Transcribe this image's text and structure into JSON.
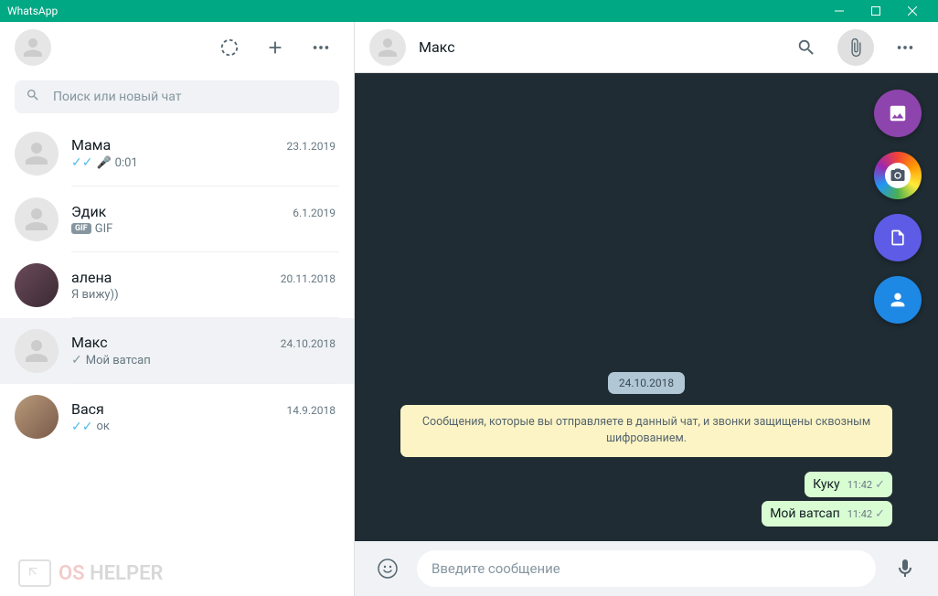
{
  "window": {
    "title": "WhatsApp"
  },
  "search": {
    "placeholder": "Поиск или новый чат"
  },
  "chats": [
    {
      "name": "Мама",
      "date": "23.1.2019",
      "preview": "0:01",
      "ticks": "blue",
      "voice": true
    },
    {
      "name": "Эдик",
      "date": "6.1.2019",
      "preview": "GIF",
      "gif": true
    },
    {
      "name": "алена",
      "date": "20.11.2018",
      "preview": "Я вижу))",
      "photo": "p1"
    },
    {
      "name": "Макс",
      "date": "24.10.2018",
      "preview": "Мой ватсап",
      "ticks": "gray",
      "selected": true
    },
    {
      "name": "Вася",
      "date": "14.9.2018",
      "preview": "ок",
      "ticks": "blue",
      "photo": "p2"
    }
  ],
  "active_chat": {
    "name": "Макс",
    "date_divider": "24.10.2018",
    "encryption_notice": "Сообщения, которые вы отправляете в данный чат, и звонки защищены сквозным шифрованием.",
    "messages": [
      {
        "text": "Куку",
        "time": "11:42"
      },
      {
        "text": "Мой ватсап",
        "time": "11:42"
      }
    ]
  },
  "composer": {
    "placeholder": "Введите сообщение"
  },
  "watermark": {
    "os": "OS",
    "helper": " HELPER"
  }
}
